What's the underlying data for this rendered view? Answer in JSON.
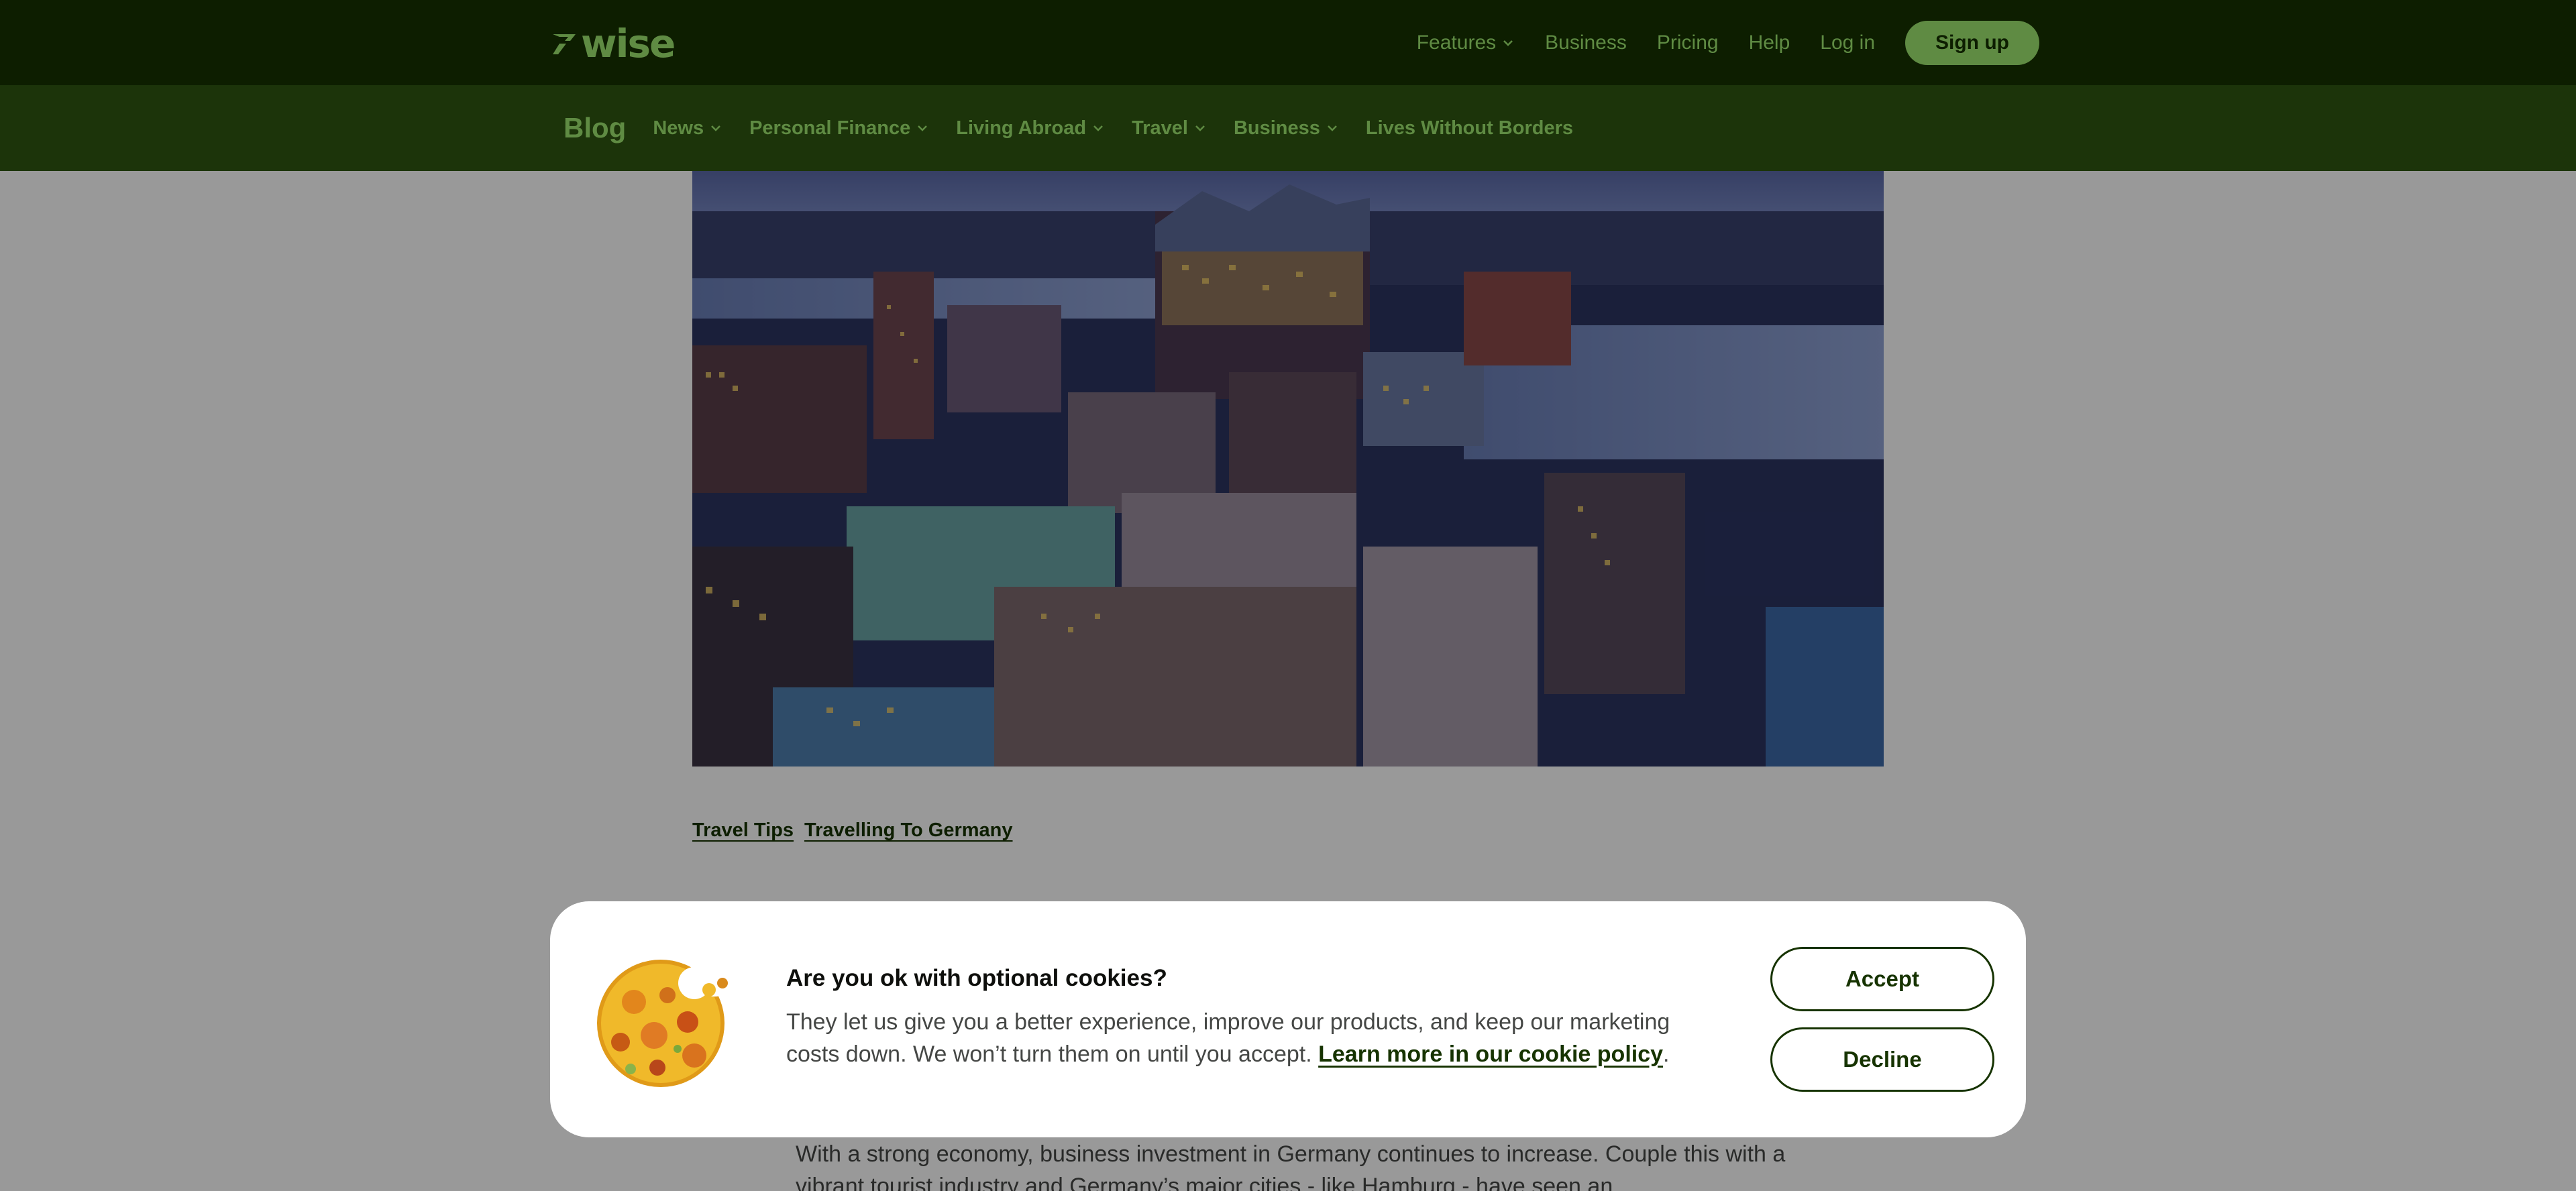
{
  "header": {
    "logo_text": "wise",
    "nav": [
      {
        "label": "Features",
        "has_dropdown": true
      },
      {
        "label": "Business",
        "has_dropdown": false
      },
      {
        "label": "Pricing",
        "has_dropdown": false
      },
      {
        "label": "Help",
        "has_dropdown": false
      },
      {
        "label": "Log in",
        "has_dropdown": false
      }
    ],
    "signup_label": "Sign up"
  },
  "blog_nav": {
    "title": "Blog",
    "items": [
      {
        "label": "News",
        "has_dropdown": true
      },
      {
        "label": "Personal Finance",
        "has_dropdown": true
      },
      {
        "label": "Living Abroad",
        "has_dropdown": true
      },
      {
        "label": "Travel",
        "has_dropdown": true
      },
      {
        "label": "Business",
        "has_dropdown": true
      },
      {
        "label": "Lives Without Borders",
        "has_dropdown": false
      }
    ]
  },
  "tags": [
    "Travel Tips",
    "Travelling To Germany"
  ],
  "article": {
    "paragraph": "With a strong economy, business investment in Germany continues to increase. Couple this with a vibrant tourist industry and Germany’s major cities - like Hamburg - have seen an"
  },
  "cookie_banner": {
    "heading": "Are you ok with optional cookies?",
    "body": "They let us give you a better experience, improve our products, and keep our marketing costs down. We won’t turn them on until you accept.",
    "link_label": "Learn more in our cookie policy",
    "link_suffix": ".",
    "accept_label": "Accept",
    "decline_label": "Decline"
  },
  "colors": {
    "header_bg": "#163300",
    "subnav_bg": "#2f5711",
    "accent_green": "#9fe870",
    "overlay": "rgba(0,0,0,0.40)"
  }
}
